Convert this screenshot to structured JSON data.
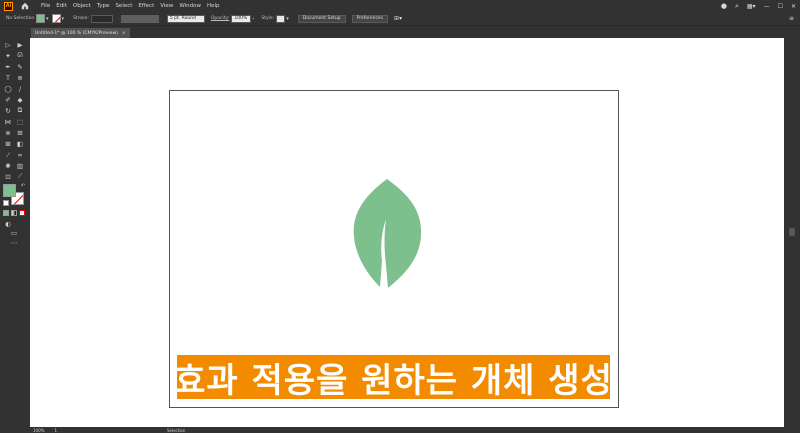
{
  "app": {
    "logo_text": "Ai",
    "home_icon": "home-icon"
  },
  "menus": [
    "File",
    "Edit",
    "Object",
    "Type",
    "Select",
    "Effect",
    "View",
    "Window",
    "Help"
  ],
  "window_controls": {
    "minimize": "—",
    "maximize": "☐",
    "close": "✕"
  },
  "control_bar": {
    "selection_label": "No Selection",
    "fill_color": "#7ebf8e",
    "stroke_label": "Stroke:",
    "brush_label": "5 pt. Round",
    "opacity_label": "Opacity:",
    "opacity_value": "100%",
    "style_label": "Style:",
    "document_setup_label": "Document Setup",
    "preferences_label": "Preferences"
  },
  "document": {
    "tab_title": "Untitled-1* @ 100 % (CMYK/Preview)",
    "close_glyph": "×"
  },
  "artwork": {
    "leaf_color": "#7ebf8e",
    "banner_color": "#f28b00",
    "banner_text": "효과 적용을 원하는 개체 생성"
  },
  "status_bar": {
    "zoom": "100%",
    "page": "1",
    "tool": "Selection"
  }
}
